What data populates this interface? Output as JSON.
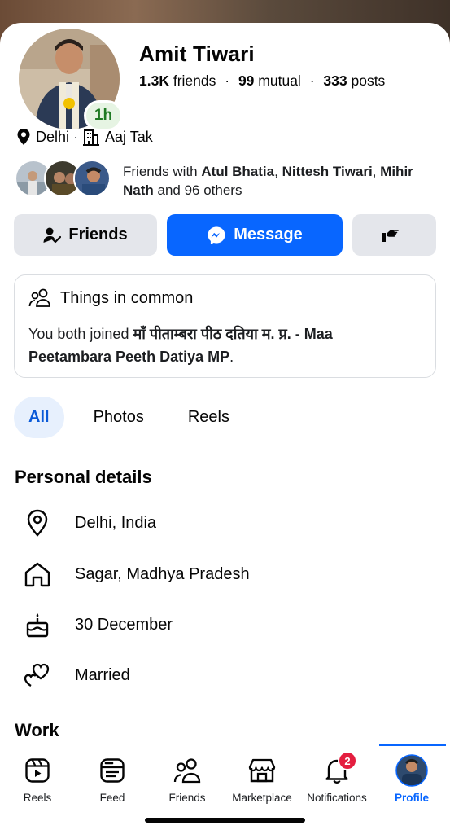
{
  "profile": {
    "name": "Amit Tiwari",
    "active_badge": "1h",
    "friends_count": "1.3K",
    "friends_label": "friends",
    "mutual_count": "99",
    "mutual_label": "mutual",
    "posts_count": "333",
    "posts_label": "posts",
    "stats_sep": "·"
  },
  "location": {
    "city": "Delhi",
    "sep": "·",
    "work": "Aaj Tak"
  },
  "mutual_friends": {
    "prefix": "Friends with ",
    "name1": "Atul Bhatia",
    "comma1": ", ",
    "name2": "Nittesh Tiwari",
    "comma2": ", ",
    "name3": "Mihir Nath",
    "suffix": " and 96 others"
  },
  "actions": {
    "friends_label": "Friends",
    "message_label": "Message"
  },
  "common": {
    "title": "Things in common",
    "text_prefix": "You both joined ",
    "group_name": "माँ पीताम्बरा पीठ दतिया म. प्र. - Maa Peetambara Peeth Datiya MP",
    "text_suffix": "."
  },
  "tabs": [
    {
      "label": "All"
    },
    {
      "label": "Photos"
    },
    {
      "label": "Reels"
    }
  ],
  "personal": {
    "title": "Personal details",
    "items": [
      {
        "text": "Delhi, India",
        "icon": "location-pin-icon"
      },
      {
        "text": "Sagar, Madhya Pradesh",
        "icon": "home-icon"
      },
      {
        "text": "30 December",
        "icon": "birthday-cake-icon"
      },
      {
        "text": "Married",
        "icon": "hearts-icon"
      }
    ]
  },
  "work": {
    "title": "Work"
  },
  "nav": {
    "items": [
      {
        "label": "Reels",
        "icon": "reels-icon"
      },
      {
        "label": "Feed",
        "icon": "feed-icon"
      },
      {
        "label": "Friends",
        "icon": "friends-icon"
      },
      {
        "label": "Marketplace",
        "icon": "marketplace-icon"
      },
      {
        "label": "Notifications",
        "icon": "bell-icon",
        "badge": "2"
      },
      {
        "label": "Profile",
        "icon": "profile-avatar"
      }
    ],
    "active": "Profile"
  },
  "colors": {
    "accent": "#0866ff",
    "button_gray": "#e4e6eb",
    "badge_green": "#1f7a23",
    "notif_red": "#e41e3f"
  }
}
